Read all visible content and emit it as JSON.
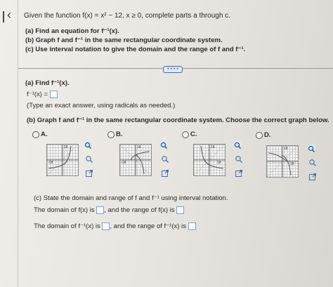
{
  "problem": {
    "intro": "Given the function f(x) = x² − 12, x ≥ 0, complete parts a through c.",
    "part_a": "(a) Find an equation for f⁻¹(x).",
    "part_b": "(b) Graph f and f⁻¹ in the same rectangular coordinate system.",
    "part_c": "(c) Use interval notation to give the domain and the range of f and f⁻¹."
  },
  "more_label": "• • • •",
  "section_a": {
    "heading": "(a) Find f⁻¹(x).",
    "answer_prefix": "f⁻¹(x) =",
    "hint": "(Type an exact answer, using radicals as needed.)"
  },
  "section_b": {
    "heading": "(b) Graph f and f⁻¹ in the same rectangular coordinate system. Choose the correct graph below.",
    "options": [
      {
        "label": "A.",
        "tick_y": "18",
        "tick_x": "-18",
        "tick_x2": "18"
      },
      {
        "label": "B.",
        "tick_y": "18",
        "tick_x": "-18",
        "tick_x2": "18"
      },
      {
        "label": "C.",
        "tick_y": "18",
        "tick_x": "-18",
        "tick_x2": "18"
      },
      {
        "label": "D.",
        "tick_y": "18",
        "tick_x": "-18",
        "tick_x2": "18"
      }
    ]
  },
  "section_c": {
    "heading": "(c) State the domain and range of f and f⁻¹ using interval notation.",
    "line1_a": "The domain of f(x) is",
    "line1_b": ", and the range of f(x) is",
    "line2_a": "The domain of f⁻¹(x) is",
    "line2_b": ", and the range of f⁻¹(x) is"
  },
  "icons": [
    "back-icon",
    "zoom-in-icon",
    "zoom-out-icon",
    "external-link-icon"
  ],
  "colors": {
    "accent": "#3a6fb0",
    "curve": "#555555"
  }
}
